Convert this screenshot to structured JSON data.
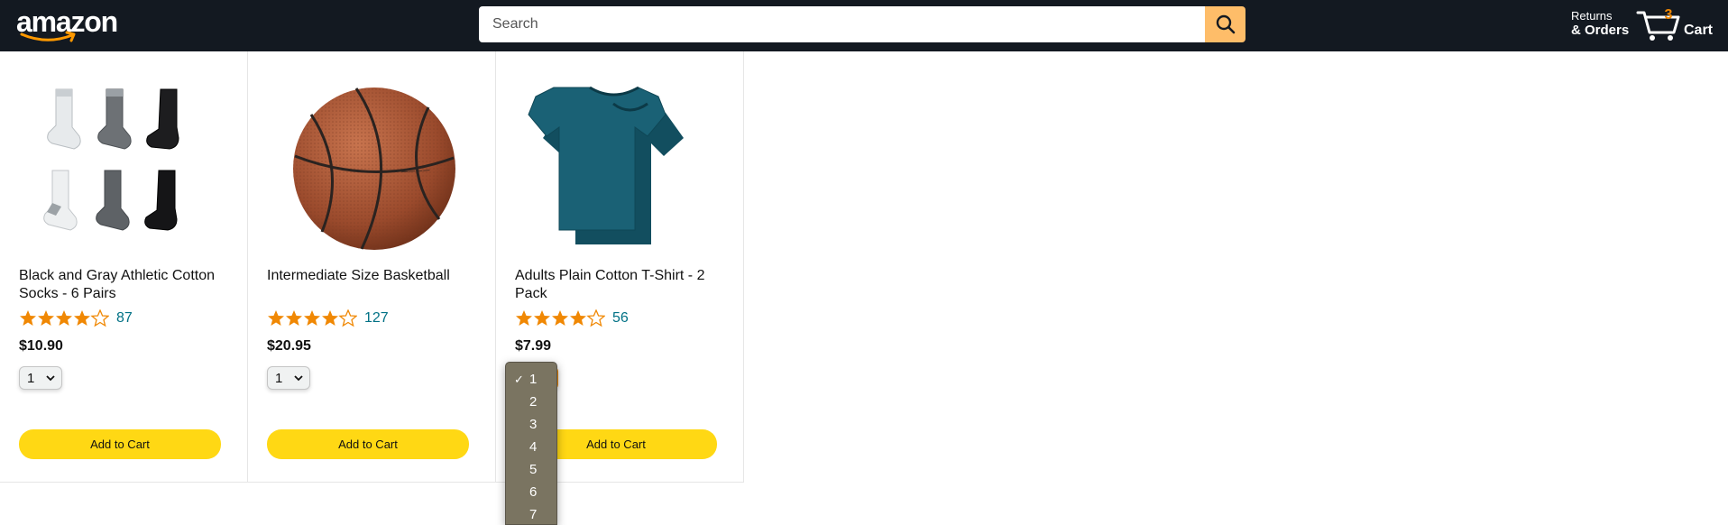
{
  "header": {
    "logo_text": "amazon",
    "search": {
      "placeholder": "Search",
      "value": ""
    },
    "returns_line1": "Returns",
    "returns_line2": "& Orders",
    "cart_count": "3",
    "cart_label": "Cart"
  },
  "products": [
    {
      "name": "Black and Gray Athletic Cotton Socks - 6 Pairs",
      "rating": 4.5,
      "rating_count": "87",
      "price": "$10.90",
      "quantity": "1",
      "add_to_cart": "Add to Cart",
      "image": "socks-image"
    },
    {
      "name": "Intermediate Size Basketball",
      "rating": 4,
      "rating_count": "127",
      "price": "$20.95",
      "quantity": "1",
      "add_to_cart": "Add to Cart",
      "image": "basketball-image"
    },
    {
      "name": "Adults Plain Cotton T-Shirt - 2 Pack",
      "rating": 4.5,
      "rating_count": "56",
      "price": "$7.99",
      "quantity": "1",
      "add_to_cart": "Add to Cart",
      "image": "tshirt-image"
    }
  ],
  "quantity_dropdown": {
    "selected": "1",
    "options": [
      "1",
      "2",
      "3",
      "4",
      "5",
      "6",
      "7"
    ],
    "check_glyph": "✓"
  },
  "colors": {
    "header_bg": "#131921",
    "search_button": "#febd69",
    "add_button": "#ffd814",
    "star": "#f08804",
    "rating_link": "#007185",
    "cart_count": "#f08804"
  }
}
